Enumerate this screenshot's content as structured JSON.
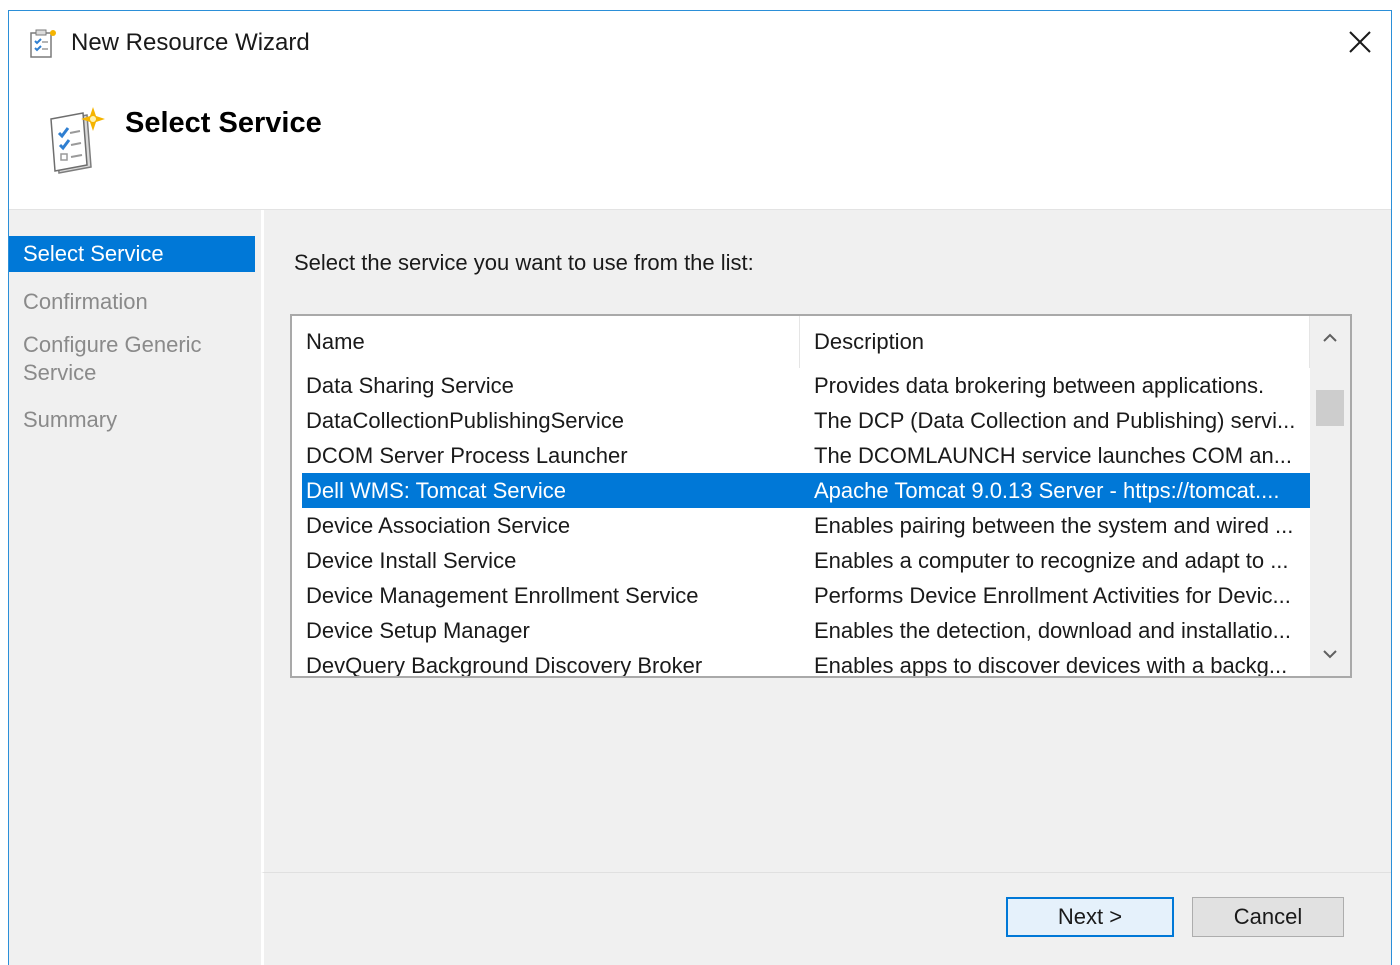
{
  "window": {
    "title": "New Resource Wizard"
  },
  "header": {
    "title": "Select Service"
  },
  "nav": {
    "items": [
      {
        "label": "Select Service",
        "active": true
      },
      {
        "label": "Confirmation",
        "active": false
      },
      {
        "label": "Configure Generic Service",
        "active": false
      },
      {
        "label": "Summary",
        "active": false
      }
    ]
  },
  "content": {
    "instruction": "Select the service you want to use from the list:",
    "list": {
      "columns": [
        "Name",
        "Description"
      ],
      "selected_index": 3,
      "rows": [
        {
          "name": "Data Sharing Service",
          "description": "Provides data brokering between applications."
        },
        {
          "name": "DataCollectionPublishingService",
          "description": "The DCP (Data Collection and Publishing) servi..."
        },
        {
          "name": "DCOM Server Process Launcher",
          "description": "The DCOMLAUNCH service launches COM an..."
        },
        {
          "name": "Dell WMS: Tomcat Service",
          "description": "Apache Tomcat 9.0.13 Server - https://tomcat...."
        },
        {
          "name": "Device Association Service",
          "description": "Enables pairing between the system and wired ..."
        },
        {
          "name": "Device Install Service",
          "description": "Enables a computer to recognize and adapt to ..."
        },
        {
          "name": "Device Management Enrollment Service",
          "description": "Performs Device Enrollment Activities for Devic..."
        },
        {
          "name": "Device Setup Manager",
          "description": "Enables the detection, download and installatio..."
        },
        {
          "name": "DevQuery Background Discovery Broker",
          "description": "Enables apps to discover devices with a backg..."
        }
      ]
    }
  },
  "footer": {
    "next_label": "Next >",
    "cancel_label": "Cancel"
  },
  "colors": {
    "accent": "#0078d7",
    "window_border": "#2b8fd8",
    "panel": "#f0f0f0"
  }
}
